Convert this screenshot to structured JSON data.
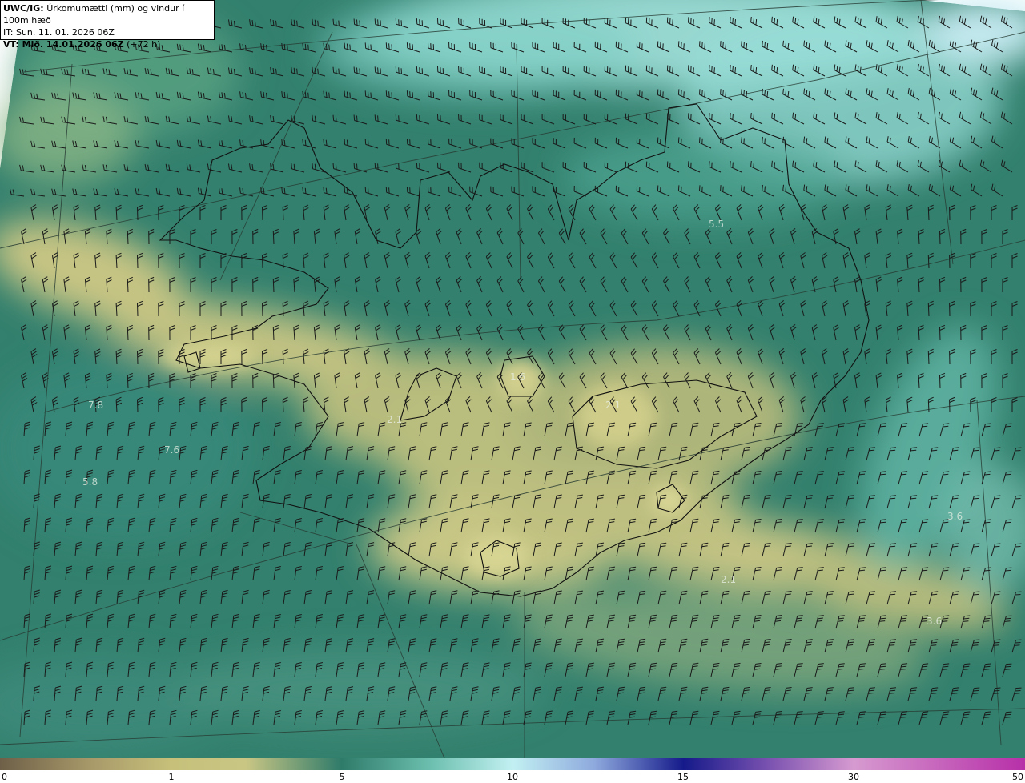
{
  "header": {
    "model": "UWC/IG:",
    "title": "Úrkomumætti (mm) og vindur í 100m hæð",
    "issue_time": "IT: Sun. 11. 01. 2026 06Z",
    "valid_prefix": "VT: Mið. 14.01.2026 06Z",
    "valid_suffix": "(+72 h)"
  },
  "map_labels": [
    "5.5",
    "7.8",
    "7.6",
    "5.8",
    "1.6",
    "2.1",
    "3.6",
    "3.6",
    "2.1",
    "2.1"
  ],
  "colorbar": {
    "ticks": [
      "0",
      "1",
      "5",
      "10",
      "15",
      "30",
      "50"
    ]
  },
  "colors": {
    "low": "#6b6048",
    "yellow": "#c9c684",
    "teal": "#2f7b6a",
    "cyan": "#b9eef0",
    "navy": "#1a1f8a",
    "magenta": "#c13ab0"
  },
  "icons": {
    "wind-barb": "wind-barb-icon",
    "coastline": "coastline"
  }
}
